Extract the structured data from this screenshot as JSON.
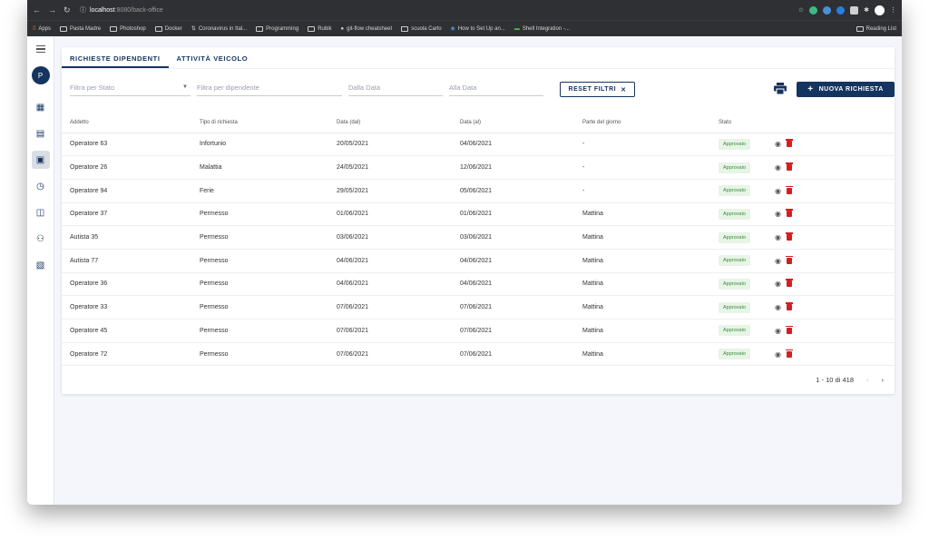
{
  "browser": {
    "url_host": "localhost",
    "url_path": ":8080/back-office",
    "bookmarks": [
      "Apps",
      "Pasta Madre",
      "Photoshop",
      "Docker",
      "Coronavirus in Ital...",
      "Programming",
      "Rubik",
      "git-flow cheatsheet",
      "scuola Carlo",
      "How to Set Up an...",
      "Shell Integration -..."
    ],
    "reading_list": "Reading List"
  },
  "sidebar": {
    "avatar_letter": "P"
  },
  "tabs": [
    "RICHIESTE DIPENDENTI",
    "ATTIVITÀ VEICOLO"
  ],
  "filters": {
    "stato_placeholder": "Filtra per Stato",
    "dipendente_placeholder": "Filtra per dipendente",
    "dalla_placeholder": "Dalla Data",
    "alla_placeholder": "Alla Data",
    "reset_label": "RESET FILTRI",
    "new_label": "NUOVA RICHIESTA"
  },
  "table": {
    "headers": [
      "Addetto",
      "Tipo di richiesta",
      "Data (dal)",
      "Data (al)",
      "Parte del giorno",
      "Stato"
    ],
    "rows": [
      [
        "Operatore 63",
        "Infortunio",
        "20/05/2021",
        "04/06/2021",
        "-",
        "Approvato"
      ],
      [
        "Operatore 26",
        "Malattia",
        "24/05/2021",
        "12/06/2021",
        "-",
        "Approvato"
      ],
      [
        "Operatore 94",
        "Ferie",
        "29/05/2021",
        "05/06/2021",
        "-",
        "Approvato"
      ],
      [
        "Operatore 37",
        "Permesso",
        "01/06/2021",
        "01/06/2021",
        "Mattina",
        "Approvato"
      ],
      [
        "Autista 35",
        "Permesso",
        "03/06/2021",
        "03/06/2021",
        "Mattina",
        "Approvato"
      ],
      [
        "Autista 77",
        "Permesso",
        "04/06/2021",
        "04/06/2021",
        "Mattina",
        "Approvato"
      ],
      [
        "Operatore 36",
        "Permesso",
        "04/06/2021",
        "04/06/2021",
        "Mattina",
        "Approvato"
      ],
      [
        "Operatore 33",
        "Permesso",
        "07/06/2021",
        "07/06/2021",
        "Mattina",
        "Approvato"
      ],
      [
        "Operatore 45",
        "Permesso",
        "07/06/2021",
        "07/06/2021",
        "Mattina",
        "Approvato"
      ],
      [
        "Operatore 72",
        "Permesso",
        "07/06/2021",
        "07/06/2021",
        "Mattina",
        "Approvato"
      ]
    ]
  },
  "pager": {
    "range": "1 - 10 di 418"
  },
  "colors": {
    "primary": "#15345f",
    "badge_bg": "#e7f4e6",
    "badge_text": "#3a8d3a",
    "danger": "#d21f1f"
  }
}
